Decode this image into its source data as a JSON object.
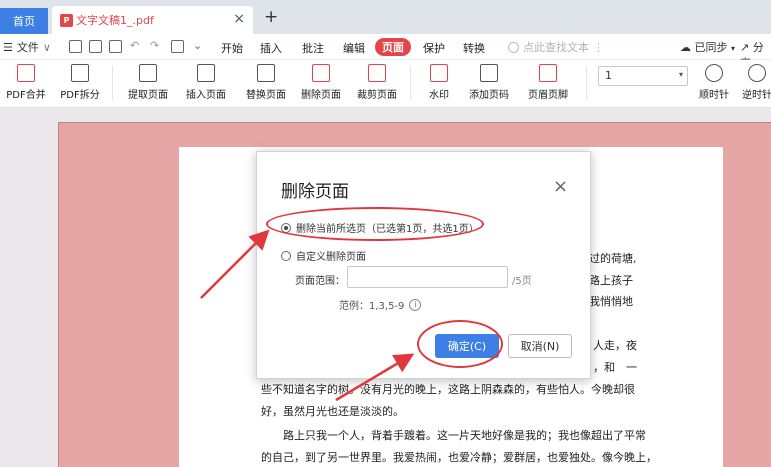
{
  "tabs": {
    "home": "首页",
    "doc_title": "文字文稿1_.pdf",
    "pdf_badge": "P",
    "close": "×",
    "new": "+"
  },
  "menu": {
    "file": "文件",
    "file_arrow": "∨",
    "tabs": [
      "开始",
      "插入",
      "批注",
      "编辑",
      "页面",
      "保护",
      "转换"
    ],
    "active_tab": "页面",
    "search_placeholder": "点此查找文本",
    "sync": "已同步",
    "share": "分享"
  },
  "ribbon": {
    "tools": [
      "PDF合并",
      "PDF拆分",
      "提取页面",
      "插入页面",
      "替换页面",
      "删除页面",
      "裁剪页面",
      "水印",
      "添加页码",
      "页眉页脚",
      "顺时针",
      "逆时针"
    ],
    "page_select_value": "1"
  },
  "document": {
    "lines": [
      "过的荷塘,",
      "路上孩子",
      "我悄悄地",
      "人走，夜",
      "，和　一",
      "些不知道名字的树。没有月光的晚上，这路上阴森森的，有些怕人。今晚却很",
      "好，虽然月光也还是淡淡的。",
      "　　路上只我一个人，背着手踱着。这一片天地好像是我的；我也像超出了平常",
      "的自己，到了另一世界里。我爱热闹，也爱冷静；爱群居，也爱独处。像今晚上，"
    ]
  },
  "dialog": {
    "title": "删除页面",
    "close": "×",
    "option_current": "删除当前所选页（已选第1页，共选1页）",
    "option_custom": "自定义删除页面",
    "range_label": "页面范围：",
    "range_value": "",
    "range_suffix": "/5页",
    "example": "范例：1,3,5-9",
    "info": "i",
    "ok": "确定(C)",
    "cancel": "取消(N)"
  },
  "colors": {
    "accent_blue": "#3d7fe4",
    "wps_red": "#e2464a",
    "annotation_red": "#e0383f",
    "document_bg": "#e7a6a6"
  }
}
